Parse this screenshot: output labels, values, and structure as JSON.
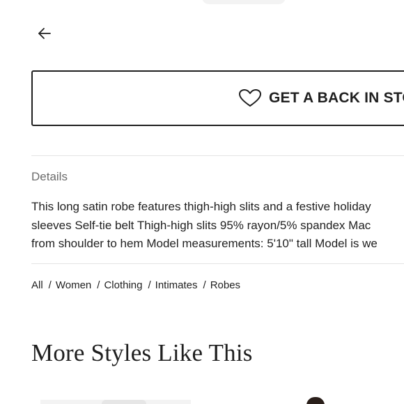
{
  "nav": {
    "back_icon": "arrow-left-icon"
  },
  "notify": {
    "icon": "heart-outline-icon",
    "label": "GET A BACK IN STOCK"
  },
  "details": {
    "heading": "Details",
    "lines": [
      "This long satin robe features thigh-high slits and a festive holiday",
      "sleeves Self-tie belt Thigh-high slits 95% rayon/5% spandex Mac",
      "from shoulder to hem Model measurements: 5'10\" tall Model is we"
    ]
  },
  "breadcrumb": {
    "items": [
      "All",
      "Women",
      "Clothing",
      "Intimates",
      "Robes"
    ],
    "separator": "/"
  },
  "more_styles": {
    "title": "More Styles Like This"
  }
}
